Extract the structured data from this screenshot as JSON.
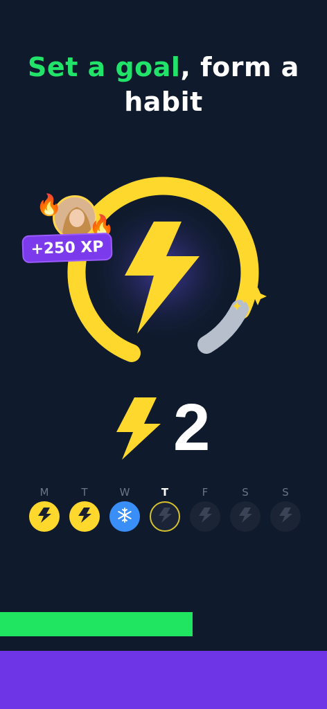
{
  "headline": {
    "accent": "Set a goal",
    "rest": ", form a habit"
  },
  "xp_badge": "+250 XP",
  "streak": {
    "count": "2",
    "icon": "lightning-bolt-icon"
  },
  "week": [
    {
      "letter": "M",
      "state": "done",
      "icon": "lightning-bolt-icon"
    },
    {
      "letter": "T",
      "state": "done",
      "icon": "lightning-bolt-icon"
    },
    {
      "letter": "W",
      "state": "freeze",
      "icon": "snowflake-icon"
    },
    {
      "letter": "T",
      "state": "today",
      "icon": "lightning-bolt-icon"
    },
    {
      "letter": "F",
      "state": "future",
      "icon": "lightning-bolt-icon"
    },
    {
      "letter": "S",
      "state": "future",
      "icon": "lightning-bolt-icon"
    },
    {
      "letter": "S",
      "state": "future",
      "icon": "lightning-bolt-icon"
    }
  ],
  "progress": 0.59,
  "colors": {
    "background": "#0f1a2c",
    "accent_green": "#22e36a",
    "bolt_yellow": "#ffd82e",
    "freeze_blue": "#3a8ef7",
    "purple": "#6d35e6"
  }
}
